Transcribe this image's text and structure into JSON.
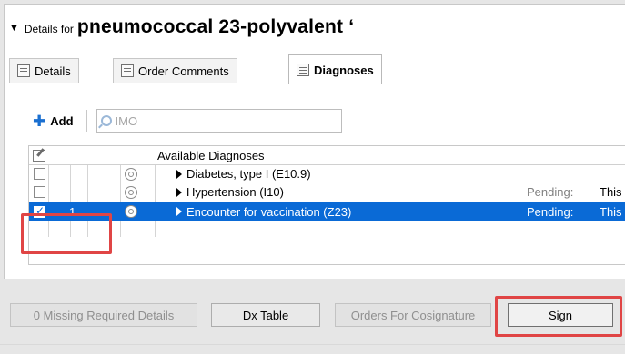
{
  "header": {
    "prefix": "Details for",
    "title": "pneumococcal 23-polyvalent ‘"
  },
  "tabs": [
    {
      "label": "Details",
      "active": false
    },
    {
      "label": "Order Comments",
      "active": false
    },
    {
      "label": "Diagnoses",
      "active": true
    }
  ],
  "toolbar": {
    "add_label": "Add",
    "search_placeholder": "IMO"
  },
  "grid": {
    "column_header": "Available Diagnoses",
    "rows": [
      {
        "checked": false,
        "number": "",
        "diagnosis": "Diabetes, type I (E10.9)",
        "status": "",
        "status_detail": ""
      },
      {
        "checked": false,
        "number": "",
        "diagnosis": "Hypertension (I10)",
        "status": "Pending:",
        "status_detail": "This"
      },
      {
        "checked": true,
        "number": "1",
        "diagnosis": "Encounter for vaccination (Z23)",
        "status": "Pending:",
        "status_detail": "This",
        "selected": true
      }
    ]
  },
  "buttons": {
    "missing": "0 Missing Required Details",
    "dx_table": "Dx Table",
    "orders_cosign": "Orders For Cosignature",
    "sign": "Sign"
  },
  "colors": {
    "selection": "#0a6ad6",
    "callout": "#e04545"
  }
}
